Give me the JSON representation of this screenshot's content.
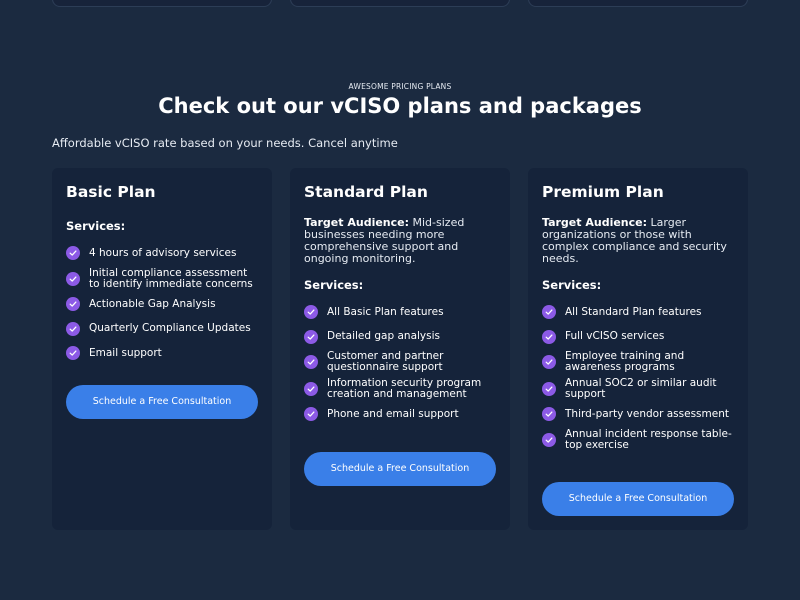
{
  "section": {
    "eyebrow": "AWESOME PRICING PLANS",
    "headline": "Check out our vCISO plans and packages",
    "subline": "Affordable vCISO rate based on your needs. Cancel anytime"
  },
  "colors": {
    "background": "#1b2a40",
    "card": "#15233a",
    "check": "#8c5ae6",
    "button": "#3a7fe8"
  },
  "plans": [
    {
      "title": "Basic Plan",
      "services_heading": "Services:",
      "features": [
        "4 hours of advisory services",
        "Initial compliance assessment to identify immediate concerns",
        "Actionable Gap Analysis",
        "Quarterly Compliance Updates",
        "Email support"
      ],
      "cta": "Schedule a Free Consultation"
    },
    {
      "title": "Standard Plan",
      "audience_label": "Target Audience:",
      "audience_text": " Mid-sized businesses needing more comprehensive support and ongoing monitoring.",
      "services_heading": "Services:",
      "features": [
        "All Basic Plan features",
        "Detailed gap analysis",
        "Customer and partner questionnaire support",
        "Information security program creation and management",
        "Phone and email support"
      ],
      "cta": "Schedule a Free Consultation"
    },
    {
      "title": "Premium Plan",
      "audience_label": "Target Audience:",
      "audience_text": " Larger organizations or those with complex compliance and security needs.",
      "services_heading": "Services:",
      "features": [
        "All Standard Plan features",
        "Full vCISO services",
        "Employee training and awareness programs",
        "Annual SOC2 or similar audit support",
        "Third-party vendor assessment",
        "Annual incident response table-top exercise"
      ],
      "cta": "Schedule a Free Consultation"
    }
  ]
}
